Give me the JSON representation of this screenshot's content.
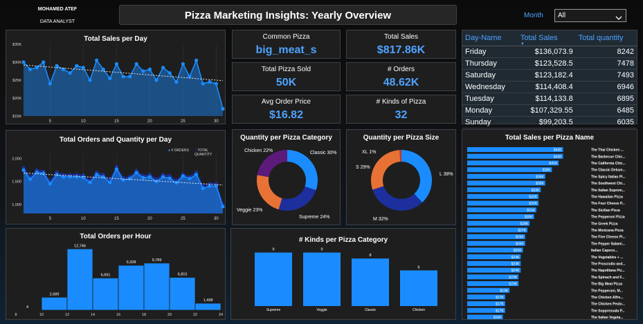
{
  "brand": {
    "name": "MOHAMED ATEF",
    "role": "DATA ANALYST"
  },
  "header": {
    "title": "Pizza Marketing Insights: Yearly Overview"
  },
  "filter": {
    "label": "Month",
    "value": "All"
  },
  "kpis": [
    {
      "label": "Common Pizza",
      "value": "big_meat_s"
    },
    {
      "label": "Total Sales",
      "value": "$817.86K"
    },
    {
      "label": "Total Pizza Sold",
      "value": "50K"
    },
    {
      "label": "# Orders",
      "value": "48.62K"
    },
    {
      "label": "Avg Order Price",
      "value": "$16.82"
    },
    {
      "label": "# Kinds of Pizza",
      "value": "32"
    }
  ],
  "day_table": {
    "headers": [
      "Day-Name",
      "Total Sales",
      "Total quantity"
    ],
    "rows": [
      [
        "Friday",
        "$136,073.9",
        "8242"
      ],
      [
        "Thursday",
        "$123,528.5",
        "7478"
      ],
      [
        "Saturday",
        "$123,182.4",
        "7493"
      ],
      [
        "Wednesday",
        "$114,408.4",
        "6946"
      ],
      [
        "Tuesday",
        "$114,133.8",
        "6895"
      ],
      [
        "Monday",
        "$107,329.55",
        "6485"
      ],
      [
        "Sunday",
        "$99,203.5",
        "6035"
      ]
    ]
  },
  "colors": {
    "accent": "#4ea3ff",
    "bar": "#1a8cff",
    "classic": "#1a8cff",
    "supreme": "#1c2f9c",
    "veggie": "#e87236",
    "chicken": "#5c1a7a",
    "pie_l": "#1a8cff",
    "pie_m": "#1c2f9c",
    "pie_s": "#e87236",
    "pie_xl": "#c0392b"
  },
  "chart_data": [
    {
      "id": "sales_per_day",
      "type": "area",
      "title": "Total Sales per Day",
      "x": [
        1,
        2,
        3,
        4,
        5,
        6,
        7,
        8,
        9,
        10,
        11,
        12,
        13,
        14,
        15,
        16,
        17,
        18,
        19,
        20,
        21,
        22,
        23,
        24,
        25,
        26,
        27,
        28,
        29,
        30,
        31
      ],
      "values": [
        30000,
        28000,
        28500,
        30000,
        24000,
        29000,
        28000,
        27000,
        29000,
        28500,
        25000,
        30500,
        28000,
        25500,
        29500,
        26000,
        26000,
        29500,
        27500,
        28000,
        25000,
        28500,
        27000,
        24500,
        29500,
        26000,
        30500,
        24000,
        24500,
        24000,
        17000
      ],
      "y_ticks": [
        "$15K",
        "$20K",
        "$25K",
        "$30K",
        "$35K"
      ],
      "ylim": [
        15000,
        35000
      ],
      "x_ticks": [
        "5",
        "10",
        "15",
        "20",
        "25",
        "30"
      ],
      "trendline": true
    },
    {
      "id": "orders_qty_per_day",
      "type": "area",
      "title": "Total Orders and Quantity per Day",
      "legend": [
        "# ORDERS",
        "TOTAL QUANTITY"
      ],
      "x": [
        1,
        2,
        3,
        4,
        5,
        6,
        7,
        8,
        9,
        10,
        11,
        12,
        13,
        14,
        15,
        16,
        17,
        18,
        19,
        20,
        21,
        22,
        23,
        24,
        25,
        26,
        27,
        28,
        29,
        30,
        31
      ],
      "series": [
        {
          "name": "# ORDERS",
          "values": [
            1750,
            1550,
            1700,
            1680,
            1450,
            1650,
            1600,
            1600,
            1600,
            1590,
            1480,
            1650,
            1600,
            1480,
            1770,
            1530,
            1560,
            1690,
            1580,
            1600,
            1500,
            1600,
            1570,
            1470,
            1620,
            1560,
            1650,
            1350,
            1400,
            1400,
            950
          ]
        },
        {
          "name": "TOTAL QUANTITY",
          "values": [
            1800,
            1600,
            1750,
            1720,
            1500,
            1700,
            1650,
            1650,
            1650,
            1640,
            1520,
            1700,
            1650,
            1530,
            1820,
            1580,
            1600,
            1740,
            1620,
            1650,
            1550,
            1650,
            1620,
            1520,
            1660,
            1600,
            1700,
            1400,
            1450,
            1450,
            1000
          ]
        }
      ],
      "y_ticks": [
        "1,000",
        "1,500",
        "2,000"
      ],
      "ylim": [
        800,
        2100
      ],
      "x_ticks": [
        "5",
        "10",
        "15",
        "20",
        "25",
        "30"
      ],
      "trendline": true
    },
    {
      "id": "orders_per_hour",
      "type": "bar",
      "title": "Total Orders per Hour",
      "categories": [
        "9",
        "10",
        "11",
        "12",
        "13",
        "14",
        "15",
        "16",
        "17",
        "18",
        "19",
        "20",
        "21",
        "22",
        "23"
      ],
      "values": [
        4,
        2689,
        12746,
        6691,
        9328,
        9789,
        6815,
        1438
      ],
      "bar_hours": [
        9,
        10,
        12,
        14,
        16,
        18,
        20,
        22
      ],
      "labels": [
        "4",
        "2,689",
        "12,746",
        "6,691",
        "9,328",
        "9,789",
        "6,815",
        "1,438"
      ],
      "x_ticks": [
        "8",
        "10",
        "12",
        "14",
        "16",
        "18",
        "20",
        "22",
        "24"
      ],
      "ylim": [
        0,
        13500
      ]
    },
    {
      "id": "kinds_per_category",
      "type": "bar",
      "title": "# Kinds per Pizza Category",
      "categories": [
        "Supreme",
        "Veggie",
        "Classic",
        "Chicken"
      ],
      "values": [
        9,
        9,
        8,
        6
      ],
      "ylim": [
        0,
        10
      ]
    },
    {
      "id": "qty_per_category",
      "type": "pie",
      "title": "Quantity per Pizza Category",
      "labels": [
        "Classic 30%",
        "Supreme 24%",
        "Veggie 23%",
        "Chicken 22%"
      ],
      "values": [
        30,
        24,
        23,
        22
      ]
    },
    {
      "id": "qty_per_size",
      "type": "pie",
      "title": "Quantity per Pizza Size",
      "labels": [
        "L 38%",
        "M 32%",
        "S 29%",
        "XL 1%"
      ],
      "values": [
        38,
        32,
        29,
        1
      ]
    },
    {
      "id": "sales_per_pizza",
      "type": "bar",
      "title": "Total Sales per Pizza Name",
      "categories": [
        "The Thai Chicken ...",
        "The Barbecue Chic...",
        "The California Chic...",
        "The Classic Deluxe...",
        "The Spicy Italian Pi...",
        "The Southwest Chi...",
        "The Italian Suprem...",
        "The Hawaiian Pizza",
        "The Four Cheese P...",
        "The Sicilian Pizza",
        "The Pepperoni Pizza",
        "The Greek Pizza",
        "The Mexicana Pizza",
        "The Five Cheese Pi...",
        "The Pepper Salami...",
        "Italian Capoco...",
        "The Vegetables + ...",
        "The Prosciutto and...",
        "The Napolitana Piz...",
        "The Spinach and F...",
        "The Big Meat Pizza",
        "The Pepperoni, M...",
        "The Chicken Alfre...",
        "The Chicken Pesto...",
        "The Soppressata P...",
        "The Italian Vegeta..."
      ],
      "values": [
        43,
        43,
        41,
        38,
        35,
        35,
        33,
        32,
        32,
        31,
        30,
        28,
        27,
        26,
        26,
        25,
        24,
        24,
        24,
        23,
        23,
        19,
        17,
        17,
        17,
        16
      ],
      "labels": [
        "$43K",
        "$43K",
        "$41K",
        "$38K",
        "$35K",
        "$35K",
        "$33K",
        "$32K",
        "$32K",
        "$31K",
        "$30K",
        "$28K",
        "$27K",
        "$26K",
        "$26K",
        "$25K",
        "$24K",
        "$24K",
        "$24K",
        "$23K",
        "$23K",
        "$19K",
        "$17K",
        "$17K",
        "$17K",
        "$16K"
      ],
      "xlim": [
        0,
        45
      ]
    }
  ]
}
